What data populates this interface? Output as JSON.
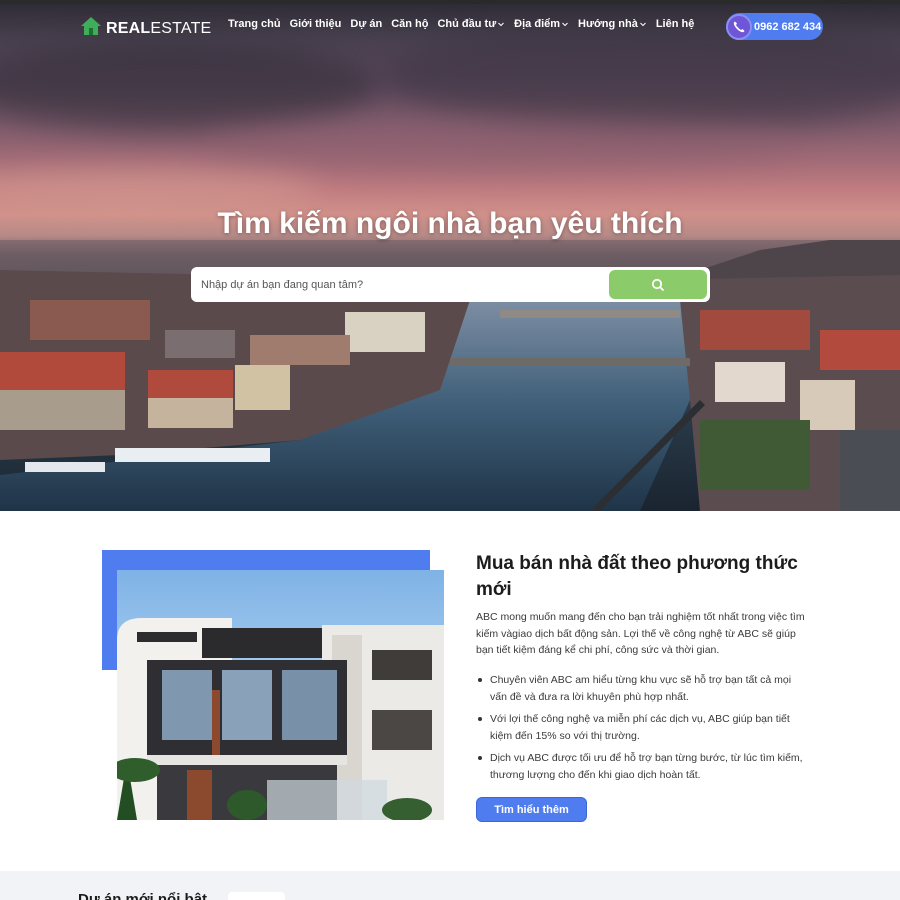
{
  "brand": {
    "logo_bold": "REAL",
    "logo_thin": "ESTATE",
    "accent": "#4f7df0",
    "search_green": "#8bcb6a"
  },
  "nav": {
    "items": [
      {
        "label": "Trang chủ",
        "dropdown": false
      },
      {
        "label": "Giới thiệu",
        "dropdown": false
      },
      {
        "label": "Dự án",
        "dropdown": false
      },
      {
        "label": "Căn hộ",
        "dropdown": false
      },
      {
        "label": "Chủ đầu tư",
        "dropdown": true
      },
      {
        "label": "Địa điểm",
        "dropdown": true
      },
      {
        "label": "Hướng nhà",
        "dropdown": true
      },
      {
        "label": "Liên hệ",
        "dropdown": false
      }
    ],
    "phone": "0962 682 434"
  },
  "hero": {
    "title": "Tìm kiếm ngôi nhà bạn yêu thích",
    "search_placeholder": "Nhập dự án bạn đang quan tâm?"
  },
  "about": {
    "title": "Mua bán nhà đất theo phương thức mới",
    "description": "ABC mong muốn mang đến cho bạn trải nghiệm tốt nhất trong việc tìm kiếm vàgiao dịch bất động sản. Lợi thế về công nghệ từ ABC sẽ giúp bạn tiết kiệm đáng kể chi phí, công sức và thời gian.",
    "bullets": [
      "Chuyên viên ABC am hiểu từng khu vực sẽ hỗ trợ bạn tất cả mọi vấn đề và đưa ra lời khuyên phù hợp nhất.",
      "Với lợi thế công nghệ va miễn phí các dịch vụ, ABC giúp bạn tiết kiệm đến 15% so với thị trường.",
      "Dịch vụ ABC được tối ưu để hỗ trợ bạn từng bước, từ lúc tìm kiếm, thương lượng cho đến khi giao dịch hoàn tất."
    ],
    "button": "Tìm hiểu thêm"
  },
  "projects": {
    "title": "Dự án mới nổi bật"
  }
}
